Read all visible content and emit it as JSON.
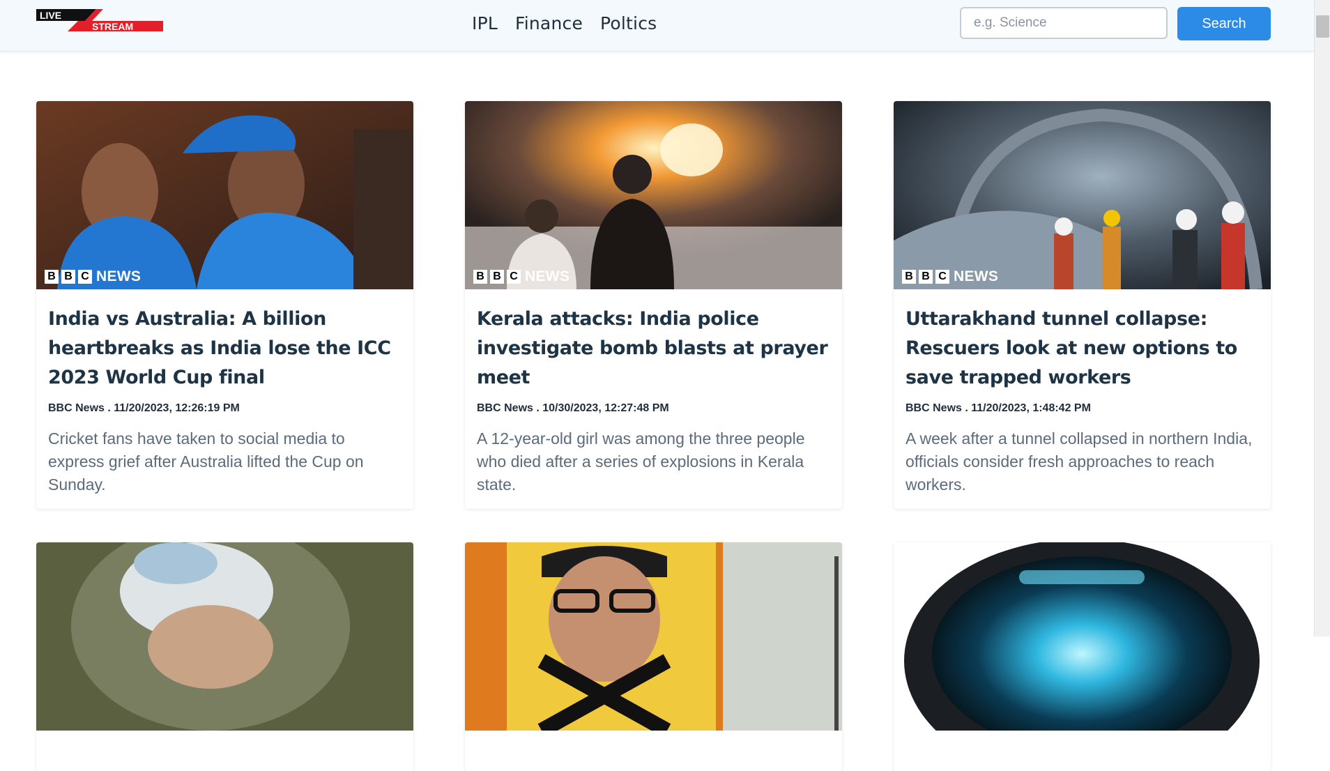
{
  "header": {
    "logo": {
      "top_text": "LIVE",
      "bottom_text": "STREAM"
    },
    "nav": [
      "IPL",
      "Finance",
      "Poltics"
    ],
    "search": {
      "placeholder": "e.g. Science",
      "value": "",
      "button_label": "Search"
    }
  },
  "badge": {
    "box_letters": [
      "B",
      "B",
      "C"
    ],
    "word": "NEWS"
  },
  "cards": [
    {
      "title": "India vs Australia: A billion heartbreaks as India lose the ICC 2023 World Cup final",
      "meta": "BBC News . 11/20/2023, 12:26:19 PM",
      "description": "Cricket fans have taken to social media to express grief after Australia lifted the Cup on Sunday."
    },
    {
      "title": "Kerala attacks: India police investigate bomb blasts at prayer meet",
      "meta": "BBC News . 10/30/2023, 12:27:48 PM",
      "description": "A 12-year-old girl was among the three people who died after a series of explosions in Kerala state."
    },
    {
      "title": "Uttarakhand tunnel collapse: Rescuers look at new options to save trapped workers",
      "meta": "BBC News . 11/20/2023, 1:48:42 PM",
      "description": "A week after a tunnel collapsed in northern India, officials consider fresh approaches to reach workers."
    },
    {
      "title": "",
      "meta": "",
      "description": ""
    },
    {
      "title": "",
      "meta": "",
      "description": ""
    },
    {
      "title": "",
      "meta": "",
      "description": ""
    }
  ],
  "colors": {
    "accent": "#2b8be6",
    "header_bg": "#f4f9fd",
    "title": "#1d3446",
    "body_text": "#5c6b7c",
    "logo_red": "#e3202a"
  }
}
